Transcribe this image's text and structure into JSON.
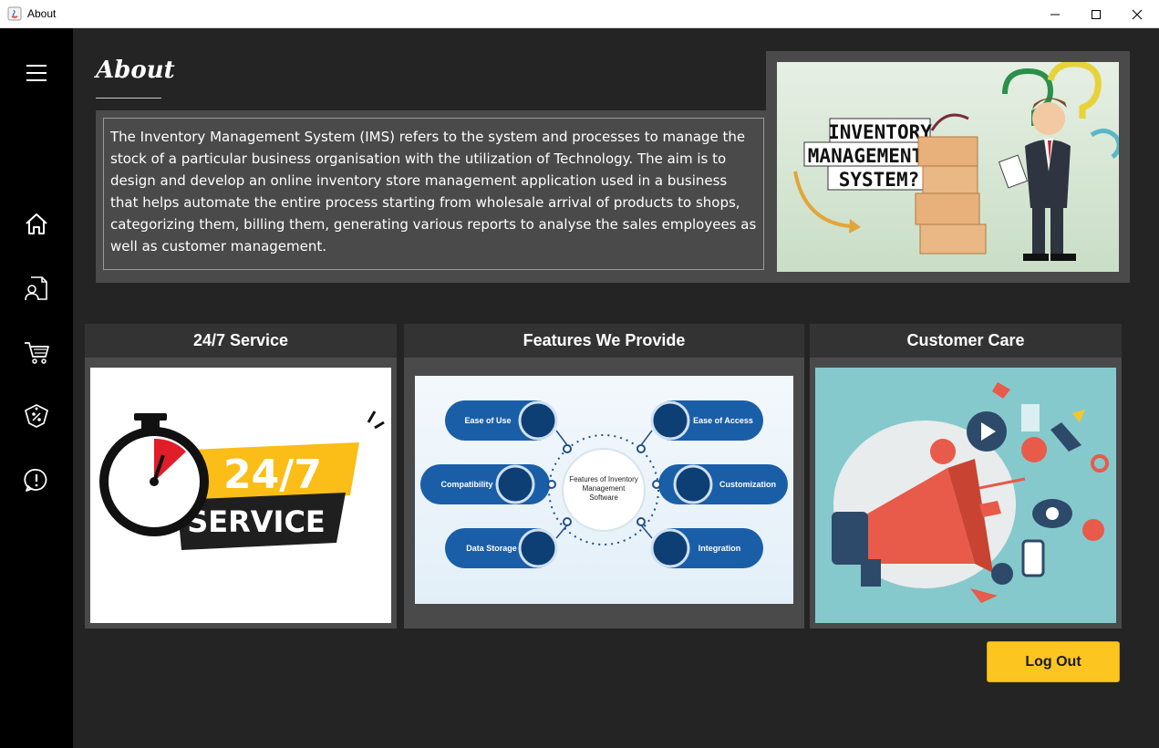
{
  "window": {
    "title": "About",
    "controls": {
      "minimize": "minimize-icon",
      "maximize": "maximize-icon",
      "close": "close-icon"
    }
  },
  "sidebar": {
    "items": [
      {
        "icon": "menu-icon"
      },
      {
        "icon": "home-icon"
      },
      {
        "icon": "user-document-icon"
      },
      {
        "icon": "cart-icon"
      },
      {
        "icon": "discount-tag-icon"
      },
      {
        "icon": "info-alert-icon"
      }
    ]
  },
  "about": {
    "title": "About",
    "description": "The Inventory Management System (IMS) refers to the system and processes to manage the stock of a particular business organisation with the utilization of Technology. The aim is to design and develop an online inventory store management application used in a business that helps automate the entire process starting from wholesale arrival of products to shops, categorizing them, billing them, generating various reports to analyse the sales employees as well as customer management.",
    "image_text": [
      "INVENTORY",
      "MANAGEMENT",
      "SYSTEM?"
    ]
  },
  "cards": [
    {
      "title": "24/7 Service",
      "image_text": [
        "24/7",
        "SERVICE"
      ]
    },
    {
      "title": "Features We Provide",
      "image": {
        "center": [
          "Features of Inventory",
          "Management",
          "Software"
        ],
        "features": [
          "Ease of Use",
          "Ease of Access",
          "Compatibility",
          "Customization",
          "Data Storage",
          "Integration"
        ]
      }
    },
    {
      "title": "Customer Care"
    }
  ],
  "actions": {
    "logout": "Log Out"
  },
  "colors": {
    "accent": "#fcc51f",
    "sidebar": "#000000",
    "background": "#242424",
    "panel": "#4a4a4a",
    "header": "#333333"
  }
}
